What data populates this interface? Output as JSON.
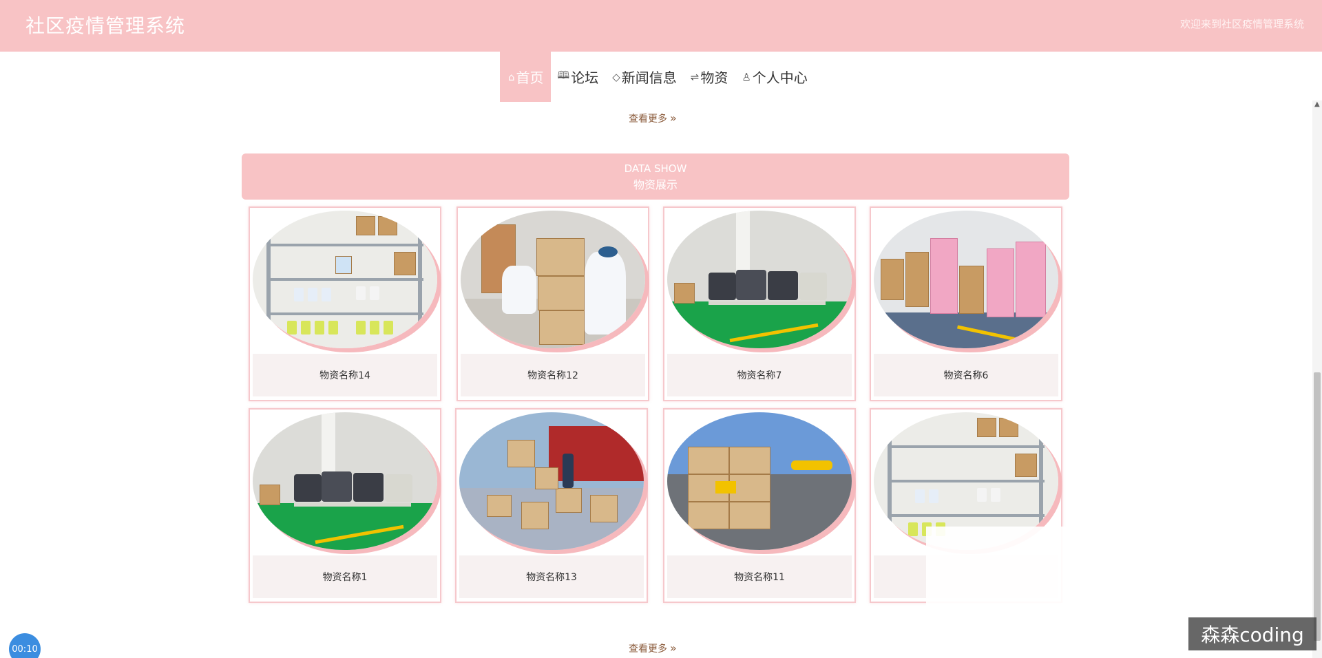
{
  "header": {
    "title": "社区疫情管理系统",
    "welcome": "欢迎来到社区疫情管理系统"
  },
  "nav": [
    {
      "label": "首页",
      "icon": "home-icon",
      "active": true
    },
    {
      "label": "论坛",
      "icon": "book-icon",
      "active": false
    },
    {
      "label": "新闻信息",
      "icon": "tag-icon",
      "active": false
    },
    {
      "label": "物资",
      "icon": "sliders-icon",
      "active": false
    },
    {
      "label": "个人中心",
      "icon": "user-icon",
      "active": false
    }
  ],
  "more_label": "查看更多",
  "section": {
    "en": "DATA SHOW",
    "cn": "物资展示"
  },
  "items": [
    {
      "name": "物资名称14",
      "scene": "shelves"
    },
    {
      "name": "物资名称12",
      "scene": "workers"
    },
    {
      "name": "物资名称7",
      "scene": "warehouse-green"
    },
    {
      "name": "物资名称6",
      "scene": "boxes-pink"
    },
    {
      "name": "物资名称1",
      "scene": "warehouse-green"
    },
    {
      "name": "物资名称13",
      "scene": "boxes-street"
    },
    {
      "name": "物资名称11",
      "scene": "cargo-plane"
    },
    {
      "name": "",
      "scene": "shelves"
    }
  ],
  "watermark": "森森coding",
  "timer": "00:10",
  "colors": {
    "brand_pink": "#f8c3c5",
    "card_border": "#f6c8cc"
  }
}
